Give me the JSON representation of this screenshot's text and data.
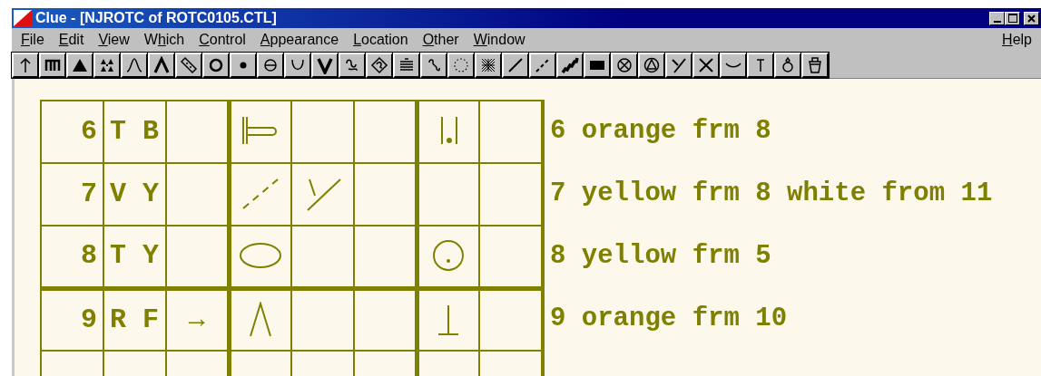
{
  "window": {
    "title": "Clue - [NJROTC of ROTC0105.CTL]"
  },
  "menu": [
    {
      "key": "F",
      "post": "ile"
    },
    {
      "key": "E",
      "post": "dit"
    },
    {
      "key": "V",
      "post": "iew"
    },
    {
      "pre": "W",
      "key": "h",
      "post": "ich"
    },
    {
      "key": "C",
      "post": "ontrol"
    },
    {
      "key": "A",
      "post": "ppearance"
    },
    {
      "key": "L",
      "post": "ocation"
    },
    {
      "key": "O",
      "post": "ther"
    },
    {
      "key": "W",
      "post": "indow"
    }
  ],
  "help_menu": {
    "key": "H",
    "post": "elp"
  },
  "table": {
    "continues": true,
    "rows": [
      {
        "number": "6",
        "letters": "T B",
        "cells": [
          {
            "kind": "tee-loop"
          },
          {
            "kind": "empty"
          },
          {
            "kind": "empty"
          },
          {
            "kind": "bar-dot-bar"
          },
          {
            "kind": "empty"
          }
        ]
      },
      {
        "number": "7",
        "letters": "V Y",
        "cells": [
          {
            "kind": "dashed-slash"
          },
          {
            "kind": "y-mark"
          },
          {
            "kind": "empty"
          },
          {
            "kind": "empty"
          },
          {
            "kind": "empty"
          }
        ]
      },
      {
        "number": "8",
        "letters": "T Y",
        "cells": [
          {
            "kind": "ellipse"
          },
          {
            "kind": "empty"
          },
          {
            "kind": "empty"
          },
          {
            "kind": "circle-dot"
          },
          {
            "kind": "empty"
          }
        ]
      },
      {
        "number": "9",
        "letters": "R F",
        "arrow": "→",
        "cells": [
          {
            "kind": "caret"
          },
          {
            "kind": "empty"
          },
          {
            "kind": "empty"
          },
          {
            "kind": "up-tack"
          },
          {
            "kind": "empty"
          }
        ]
      }
    ]
  },
  "notes": [
    "6 orange frm 8",
    "7 yellow frm 8 white from 11",
    "8 yellow frm 5",
    "9 orange frm 10"
  ]
}
